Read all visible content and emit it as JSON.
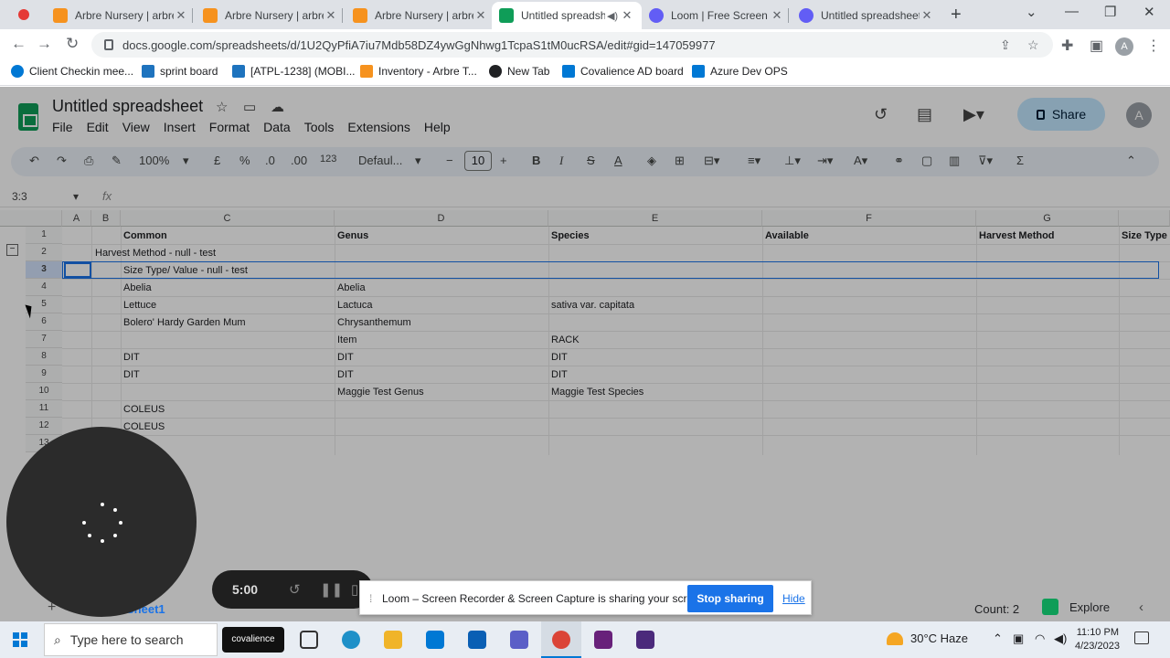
{
  "browser": {
    "tabs": [
      {
        "title": "Arbre Nursery | arbre",
        "favicon_color": "#f6921e",
        "active": false
      },
      {
        "title": "Arbre Nursery | arbre",
        "favicon_color": "#f6921e",
        "active": false
      },
      {
        "title": "Arbre Nursery | arbre",
        "favicon_color": "#f6921e",
        "active": false
      },
      {
        "title": "Untitled spreadsh",
        "favicon_color": "#0f9d58",
        "active": true
      },
      {
        "title": "Loom | Free Screen &",
        "favicon_color": "#625df5",
        "active": false
      },
      {
        "title": "Untitled spreadsheet",
        "favicon_color": "#625df5",
        "active": false
      }
    ],
    "url": "docs.google.com/spreadsheets/d/1U2QyPfiA7iu7Mdb58DZ4ywGgNhwg1TcpaS1tM0ucRSA/edit#gid=147059977",
    "profile_initial": "A",
    "bookmarks": [
      {
        "label": "Client Checkin mee...",
        "color": "#0078d4"
      },
      {
        "label": "sprint board",
        "color": "#1e73be"
      },
      {
        "label": "[ATPL-1238] (MOBI...",
        "color": "#1e73be"
      },
      {
        "label": "Inventory - Arbre T...",
        "color": "#f6921e"
      },
      {
        "label": "New Tab",
        "color": "#202124"
      },
      {
        "label": "Covalience AD board",
        "color": "#0078d4"
      },
      {
        "label": "Azure Dev OPS",
        "color": "#0078d4"
      }
    ]
  },
  "sheets": {
    "title": "Untitled spreadsheet",
    "menus": [
      "File",
      "Edit",
      "View",
      "Insert",
      "Format",
      "Data",
      "Tools",
      "Extensions",
      "Help"
    ],
    "share_label": "Share",
    "user_initial": "A",
    "toolbar": {
      "zoom": "100%",
      "currency": "£",
      "percent": "%",
      "dec_dec": ".0",
      "dec_inc": ".00",
      "format_123": "123",
      "font": "Defaul...",
      "font_size": "10"
    },
    "name_box": "3:3",
    "fx": "fx",
    "columns": [
      "A",
      "B",
      "C",
      "D",
      "E",
      "F",
      "G"
    ],
    "row_numbers": [
      "1",
      "2",
      "3",
      "4",
      "5",
      "6",
      "7",
      "8",
      "9",
      "10",
      "11",
      "12",
      "13"
    ],
    "header_row": {
      "common": "Common",
      "genus": "Genus",
      "species": "Species",
      "available": "Available",
      "harvest": "Harvest Method",
      "size_type": "Size Type"
    },
    "group_rows": {
      "row2": "Harvest Method - null - test",
      "row3": "Size Type/ Value - null - test"
    },
    "rows": [
      {
        "common": "Abelia",
        "genus": "Abelia",
        "species": ""
      },
      {
        "common": "Lettuce",
        "genus": "Lactuca",
        "species": "sativa var. capitata"
      },
      {
        "common": "Bolero' Hardy Garden Mum",
        "genus": "Chrysanthemum",
        "species": ""
      },
      {
        "common": "",
        "genus": "Item",
        "species": "RACK"
      },
      {
        "common": "DIT",
        "genus": "DIT",
        "species": "DIT"
      },
      {
        "common": "DIT",
        "genus": "DIT",
        "species": "DIT"
      },
      {
        "common": "",
        "genus": "Maggie Test Genus",
        "species": "Maggie Test Species"
      },
      {
        "common": "COLEUS",
        "genus": "",
        "species": ""
      },
      {
        "common": "COLEUS",
        "genus": "",
        "species": ""
      }
    ],
    "sheet_tab": "Sheet1",
    "count": "Count: 2",
    "explore": "Explore"
  },
  "loom": {
    "timer": "5:00",
    "message": "Loom – Screen Recorder & Screen Capture is sharing your screen.",
    "stop_label": "Stop sharing",
    "hide_label": "Hide"
  },
  "taskbar": {
    "search_placeholder": "Type here to search",
    "covalience_label": "covalience",
    "weather": "30°C  Haze",
    "time": "11:10 PM",
    "date": "4/23/2023"
  }
}
